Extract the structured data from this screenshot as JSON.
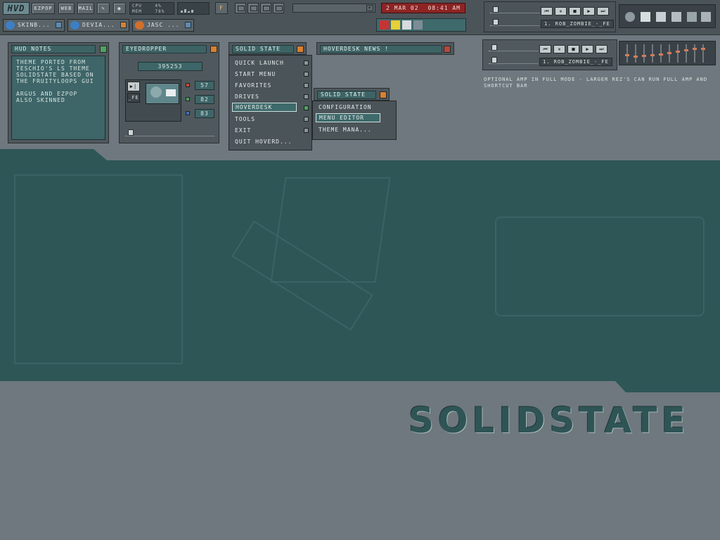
{
  "topbar": {
    "logo": "HVD",
    "buttons": [
      "EZPOP",
      "WEB",
      "MAIL"
    ],
    "cpu_label": "CPU",
    "cpu_value": "4%",
    "mem_label": "MEM",
    "mem_value": "78%",
    "f_button": "F",
    "date": "2 MAR 02",
    "time": "08:41 AM"
  },
  "taskbar": {
    "tasks": [
      {
        "label": "SKINB...",
        "icon": "ie-icon"
      },
      {
        "label": "DEVIA...",
        "icon": "ie-icon"
      },
      {
        "label": "JASC ...",
        "icon": "jasc-icon"
      }
    ]
  },
  "amp_small": {
    "track": "1. ROB_ZOMBIE_-_FE"
  },
  "amp_full": {
    "track": "1. ROB_ZOMBIE_-_FE",
    "note": "OPTIONAL AMP IN FULL MODE - LARGER REZ'S CAN RUN FULL AMP AND SHORTCUT BAR"
  },
  "hud_notes": {
    "title": "HUD NOTES",
    "lines": [
      "THEME PORTED FROM",
      "TESCHIO'S LS THEME",
      "SOLIDSTATE BASED ON",
      "THE FRUITYLOOPS GUI",
      "",
      "ARGUS AND EZPOP",
      "ALSO SKINNED"
    ]
  },
  "eyedropper": {
    "title": "EYEDROPPER",
    "hex": "395253",
    "r": "57",
    "g": "82",
    "b": "83",
    "mini_track": "_FE"
  },
  "solid_menu": {
    "title": "SOLID STATE",
    "items": [
      "QUICK LAUNCH",
      "START MENU",
      "FAVORITES",
      "DRIVES",
      "HOVERDESK",
      "TOOLS",
      "EXIT",
      "QUIT HOVERD..."
    ]
  },
  "submenu": {
    "title": "SOLID STATE",
    "items": [
      "CONFIGURATION",
      "MENU EDITOR",
      "THEME MANA..."
    ]
  },
  "news": {
    "title": "HOVERDESK NEWS !"
  },
  "desktop": {
    "brand": "SOLIDSTATE"
  }
}
